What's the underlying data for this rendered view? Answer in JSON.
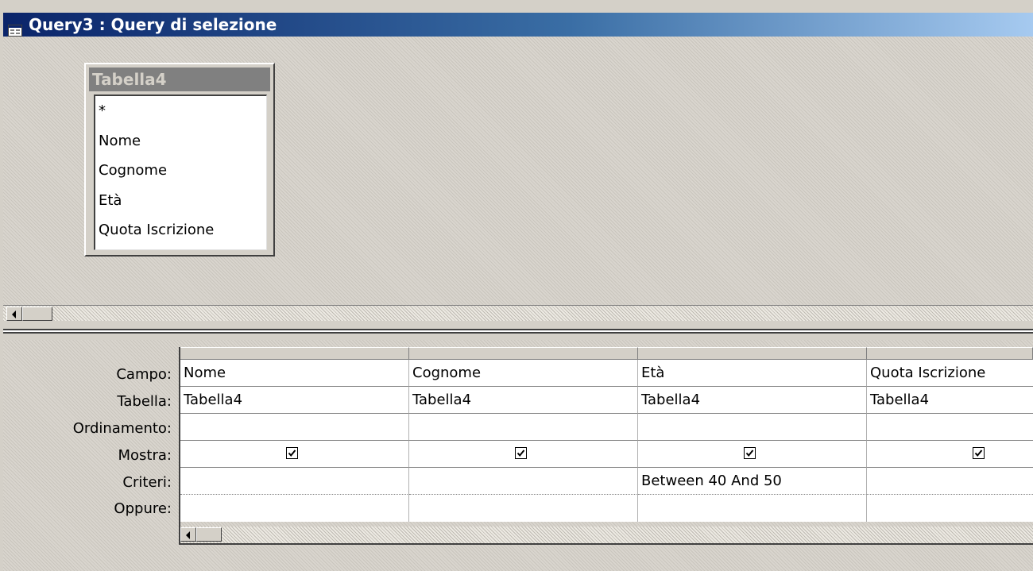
{
  "window": {
    "title": "Query3 : Query di selezione",
    "icon": "query-icon"
  },
  "field_list": {
    "table_name": "Tabella4",
    "fields": [
      "*",
      "Nome",
      "Cognome",
      "Età",
      "Quota Iscrizione"
    ]
  },
  "design_grid": {
    "row_labels": {
      "field": "Campo:",
      "table": "Tabella:",
      "sort": "Ordinamento:",
      "show": "Mostra:",
      "criteria": "Criteri:",
      "or": "Oppure:"
    },
    "columns": [
      {
        "field": "Nome",
        "table": "Tabella4",
        "sort": "",
        "show": true,
        "criteria": "",
        "or": ""
      },
      {
        "field": "Cognome",
        "table": "Tabella4",
        "sort": "",
        "show": true,
        "criteria": "",
        "or": ""
      },
      {
        "field": "Età",
        "table": "Tabella4",
        "sort": "",
        "show": true,
        "criteria": "Between 40 And 50",
        "or": ""
      },
      {
        "field": "Quota Iscrizione",
        "table": "Tabella4",
        "sort": "",
        "show": true,
        "criteria": "",
        "or": ""
      }
    ]
  },
  "icons": {
    "scroll_left": "arrow-left-icon",
    "checkbox_checked": "checkmark-icon"
  }
}
